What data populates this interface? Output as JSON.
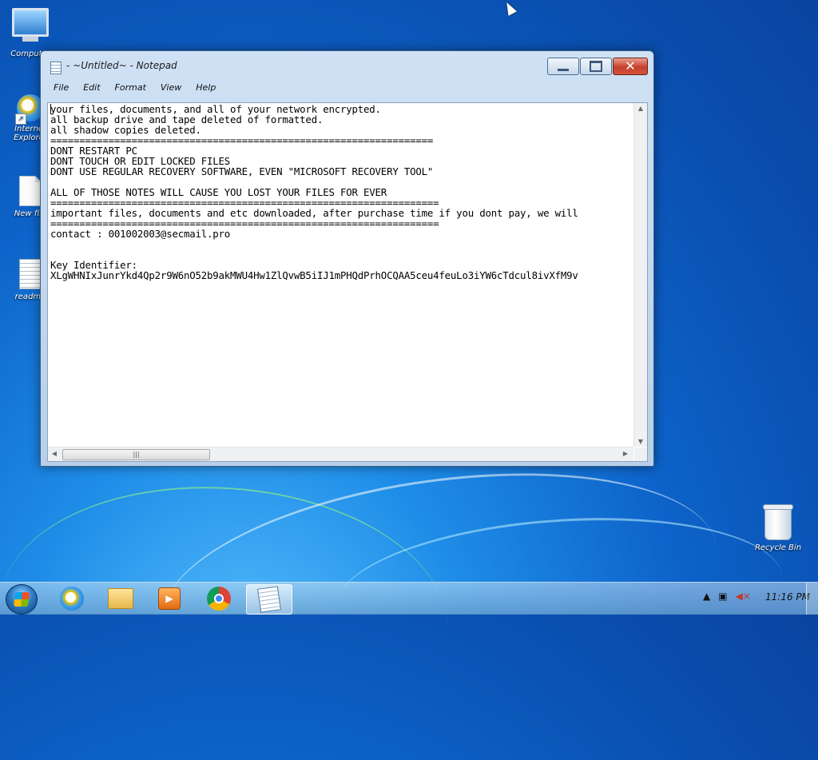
{
  "desktop": {
    "icons": [
      {
        "label": "Computer",
        "glyph": "computer-icon"
      },
      {
        "label": "Internet Explorer",
        "glyph": "ie-icon"
      },
      {
        "label": "New file",
        "glyph": "file-icon"
      },
      {
        "label": "readme",
        "glyph": "text-file-icon"
      },
      {
        "label": "Recycle Bin",
        "glyph": "recycle-bin-icon"
      }
    ]
  },
  "window": {
    "title": "- ~Untitled~ - Notepad",
    "menu": [
      "File",
      "Edit",
      "Format",
      "View",
      "Help"
    ],
    "lines": [
      "your files, documents, and all of your network encrypted.",
      "all backup drive and tape deleted of formatted.",
      "all shadow copies deleted.",
      "==================================================================",
      "DONT RESTART PC",
      "DONT TOUCH OR EDIT LOCKED FILES",
      "DONT USE REGULAR RECOVERY SOFTWARE, EVEN \"MICROSOFT RECOVERY TOOL\"",
      "",
      "ALL OF THOSE NOTES WILL CAUSE YOU LOST YOUR FILES FOR EVER",
      "===================================================================",
      "important files, documents and etc downloaded, after purchase time if you dont pay, we will",
      "===================================================================",
      "contact : 001002003@secmail.pro",
      "",
      "",
      "Key Identifier:",
      "XLgWHNIxJunrYkd4Qp2r9W6nO52b9akMWU4Hw1ZlQvwB5iIJ1mPHQdPrhOCQAA5ceu4feuLo3iYW6cTdcul8ivXfM9v"
    ]
  },
  "taskbar": {
    "clock": "11:16 PM",
    "pinned": [
      "internet-explorer",
      "windows-explorer",
      "media-player",
      "chrome",
      "notepad"
    ]
  }
}
